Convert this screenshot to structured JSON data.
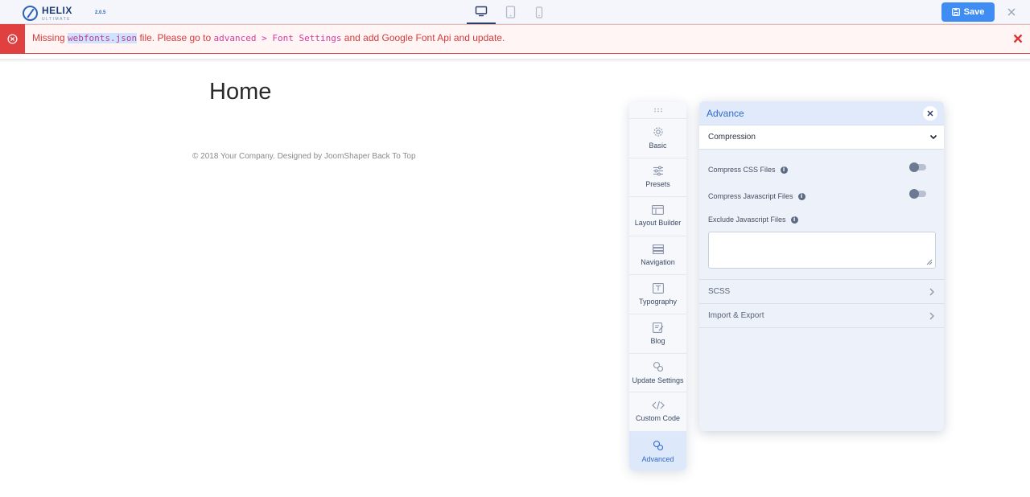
{
  "app": {
    "brand": "HELIX",
    "brand_sub": "ULTIMATE",
    "version": "2.0.5",
    "accent": "#3f8cf2"
  },
  "topbar": {
    "devices": [
      {
        "name": "desktop-icon",
        "active": true
      },
      {
        "name": "tablet-icon",
        "active": false
      },
      {
        "name": "mobile-icon",
        "active": false
      }
    ],
    "save_label": "Save"
  },
  "alert": {
    "prefix": "Missing ",
    "file": "webfonts.json",
    "middle": " file. Please go to ",
    "path": "advanced > Font Settings",
    "suffix": " and add Google Font Api and update."
  },
  "page": {
    "title": "Home",
    "footer": "© 2018 Your Company. Designed by JoomShaper Back To Top"
  },
  "sidenav": {
    "items": [
      {
        "label": "Basic",
        "icon": "gear-icon"
      },
      {
        "label": "Presets",
        "icon": "sliders-icon"
      },
      {
        "label": "Layout Builder",
        "icon": "layout-icon"
      },
      {
        "label": "Navigation",
        "icon": "navigation-icon"
      },
      {
        "label": "Typography",
        "icon": "typography-icon"
      },
      {
        "label": "Blog",
        "icon": "blog-icon"
      },
      {
        "label": "Update Settings",
        "icon": "update-icon"
      },
      {
        "label": "Custom Code",
        "icon": "code-icon"
      },
      {
        "label": "Advanced",
        "icon": "advanced-icon"
      }
    ]
  },
  "panel": {
    "title": "Advance",
    "compression": {
      "title": "Compression",
      "compress_css": "Compress CSS Files",
      "compress_js": "Compress Javascript Files",
      "exclude_js": "Exclude Javascript Files",
      "exclude_js_value": ""
    },
    "scss": "SCSS",
    "import_export": "Import & Export"
  }
}
